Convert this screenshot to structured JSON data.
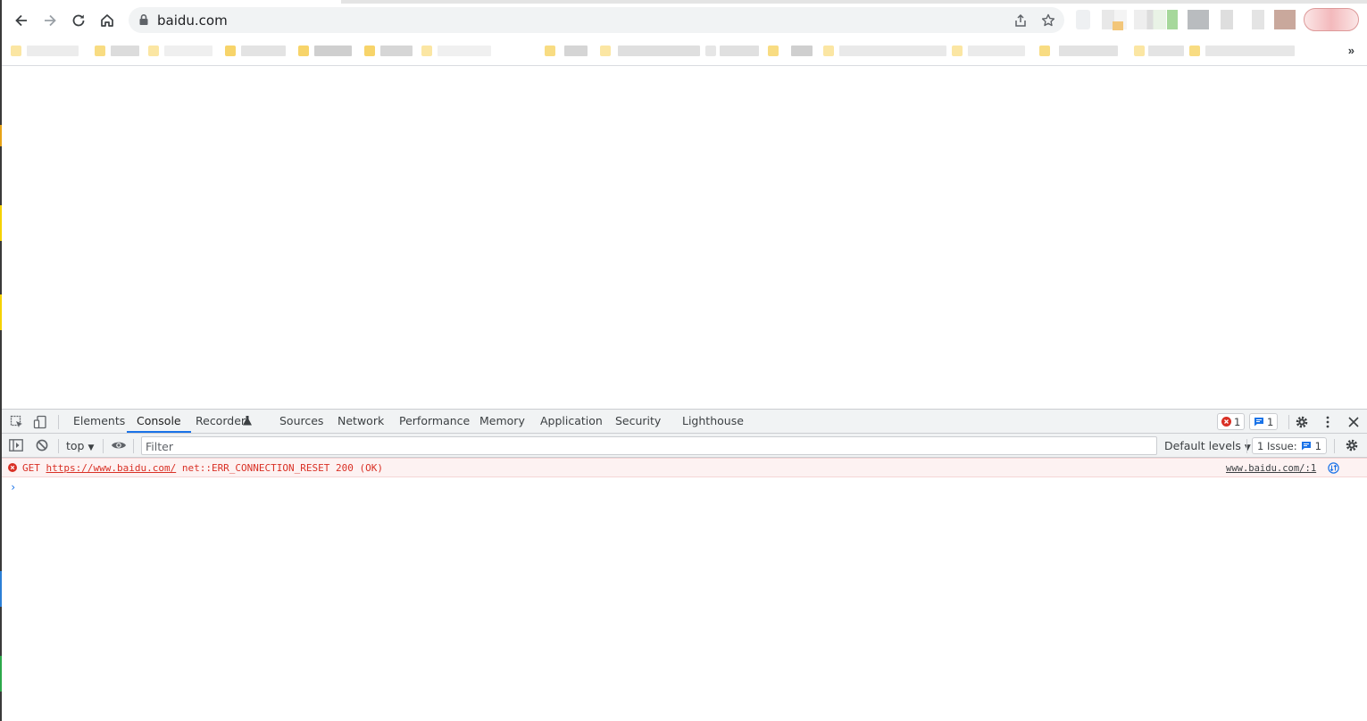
{
  "browser": {
    "url": "baidu.com",
    "bookmarks_overflow": "»",
    "icons": [
      "back-icon",
      "forward-icon",
      "reload-icon",
      "home-icon",
      "lock-icon",
      "share-icon",
      "star-icon",
      "menu-icon"
    ]
  },
  "devtools": {
    "tabs": [
      {
        "label": "Elements"
      },
      {
        "label": "Console"
      },
      {
        "label": "Recorder"
      },
      {
        "label": "Sources"
      },
      {
        "label": "Network"
      },
      {
        "label": "Performance"
      },
      {
        "label": "Memory"
      },
      {
        "label": "Application"
      },
      {
        "label": "Security"
      },
      {
        "label": "Lighthouse"
      }
    ],
    "active_tab": "Console",
    "error_count": "1",
    "message_count": "1",
    "console": {
      "context": "top",
      "filter_placeholder": "Filter",
      "levels": "Default levels",
      "issues_label": "1 Issue:",
      "issues_count": "1",
      "error": {
        "method": "GET",
        "url": "https://www.baidu.com/",
        "detail": "net::ERR_CONNECTION_RESET 200 (OK)",
        "source": "www.baidu.com/:1"
      },
      "prompt": "›"
    }
  },
  "colors": {
    "accent": "#1a73e8",
    "error": "#d93025",
    "error_bg": "#fdf2f2"
  }
}
